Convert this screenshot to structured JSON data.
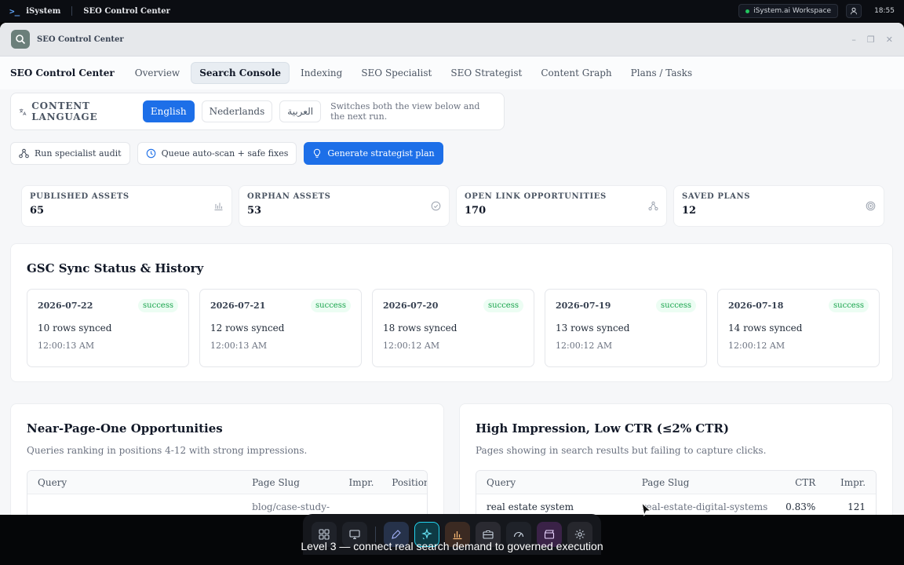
{
  "os_bar": {
    "brand": "iSystem",
    "title": "SEO Control Center",
    "workspace": "iSystem.ai Workspace",
    "time": "18:55"
  },
  "window": {
    "title": "SEO Control Center"
  },
  "nav": {
    "brand": "SEO Control Center",
    "tabs": [
      {
        "label": "Overview"
      },
      {
        "label": "Search Console",
        "active": true
      },
      {
        "label": "Indexing"
      },
      {
        "label": "SEO Specialist"
      },
      {
        "label": "SEO Strategist"
      },
      {
        "label": "Content Graph"
      },
      {
        "label": "Plans / Tasks"
      }
    ]
  },
  "language": {
    "label": "CONTENT LANGUAGE",
    "options": [
      "English",
      "Nederlands",
      "العربية"
    ],
    "selected": "English",
    "hint": "Switches both the view below and the next run."
  },
  "actions": {
    "audit": "Run specialist audit",
    "queue": "Queue auto-scan + safe fixes",
    "plan": "Generate strategist plan"
  },
  "stats": [
    {
      "label": "PUBLISHED ASSETS",
      "value": "65",
      "icon": "bar-chart-icon"
    },
    {
      "label": "ORPHAN ASSETS",
      "value": "53",
      "icon": "check-circle-icon"
    },
    {
      "label": "OPEN LINK OPPORTUNITIES",
      "value": "170",
      "icon": "network-icon"
    },
    {
      "label": "SAVED PLANS",
      "value": "12",
      "icon": "target-icon"
    }
  ],
  "gsc": {
    "title": "GSC Sync Status & History",
    "history": [
      {
        "date": "2026-07-22",
        "status": "success",
        "rows": "10 rows synced",
        "time": "12:00:13 AM"
      },
      {
        "date": "2026-07-21",
        "status": "success",
        "rows": "12 rows synced",
        "time": "12:00:13 AM"
      },
      {
        "date": "2026-07-20",
        "status": "success",
        "rows": "18 rows synced",
        "time": "12:00:12 AM"
      },
      {
        "date": "2026-07-19",
        "status": "success",
        "rows": "13 rows synced",
        "time": "12:00:12 AM"
      },
      {
        "date": "2026-07-18",
        "status": "success",
        "rows": "14 rows synced",
        "time": "12:00:12 AM"
      }
    ]
  },
  "near_page": {
    "title": "Near-Page-One Opportunities",
    "subtitle": "Queries ranking in positions 4-12 with strong impressions.",
    "columns": [
      "Query",
      "Page Slug",
      "Impr.",
      "Position"
    ],
    "rows": [
      {
        "query": "",
        "slug": "blog/case-study-",
        "impr": "",
        "position": ""
      }
    ]
  },
  "low_ctr": {
    "title": "High Impression, Low CTR (≤2% CTR)",
    "subtitle": "Pages showing in search results but failing to capture clicks.",
    "columns": [
      "Query",
      "Page Slug",
      "CTR",
      "Impr."
    ],
    "rows": [
      {
        "query": "real estate system",
        "slug": "real-estate-digital-systems",
        "ctr": "0.83%",
        "impr": "121"
      }
    ]
  },
  "dock": {
    "items": [
      "grid-icon",
      "monitor-icon",
      "pen-icon",
      "sparkle-icon",
      "chart-icon",
      "briefcase-icon",
      "gauge-icon",
      "clapper-icon",
      "gear-icon"
    ],
    "active": "sparkle-icon"
  },
  "caption": "Level 3 — connect real search demand to governed execution",
  "colors": {
    "accent": "#1d6fe8",
    "success": "#16a34a"
  }
}
